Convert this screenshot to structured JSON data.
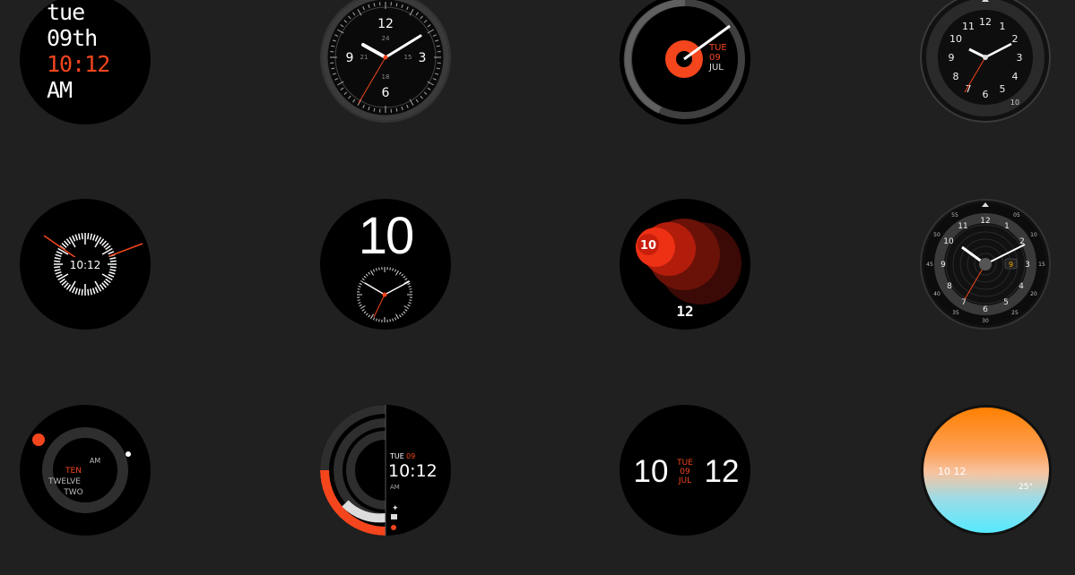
{
  "faces": {
    "f1": {
      "day": "tue",
      "date": "09th",
      "time": "10:12",
      "ampm": "AM"
    },
    "f2": {
      "n12": "12",
      "n3": "3",
      "n6": "6",
      "n9": "9",
      "n24": "24",
      "n15": "15",
      "n18": "18",
      "n21": "21"
    },
    "f3": {
      "day": "TUE",
      "date": "09",
      "month": "JUL"
    },
    "f4": {
      "n12": "12",
      "n1": "1",
      "n2": "2",
      "n3": "3",
      "n4": "4",
      "n5": "5",
      "n6": "6",
      "n7": "7",
      "n8": "8",
      "n9": "9",
      "n10": "10",
      "n11": "11",
      "n10b": "10"
    },
    "f5": {
      "time": "10:12"
    },
    "f6": {
      "hour": "10"
    },
    "f7": {
      "hour": "10",
      "minute": "12"
    },
    "f8": {
      "n12": "12",
      "n3": "3",
      "n6": "6",
      "n9": "9",
      "n11": "11",
      "n1": "1",
      "n2": "2",
      "n4": "4",
      "n5": "5",
      "n7": "7",
      "n8": "8",
      "n10": "10",
      "date": "9",
      "o05": "05",
      "o10": "10",
      "o15": "15",
      "o20": "20",
      "o25": "25",
      "o30": "30",
      "o35": "35",
      "o40": "40",
      "o45": "45",
      "o50": "50",
      "o55": "55"
    },
    "f9": {
      "line1": "AM",
      "line2": "TEN",
      "line3": "TWELVE",
      "line4": "TWO"
    },
    "f10": {
      "day": "TUE",
      "date": "09",
      "time": "10:12",
      "ampm": "AM"
    },
    "f11": {
      "hour": "10",
      "day": "TUE",
      "date": "09",
      "month": "JUL",
      "minute": "12"
    },
    "f12": {
      "time": "10 12",
      "temp": "25°"
    }
  },
  "colors": {
    "accent": "#f4451d",
    "background": "#202020"
  }
}
